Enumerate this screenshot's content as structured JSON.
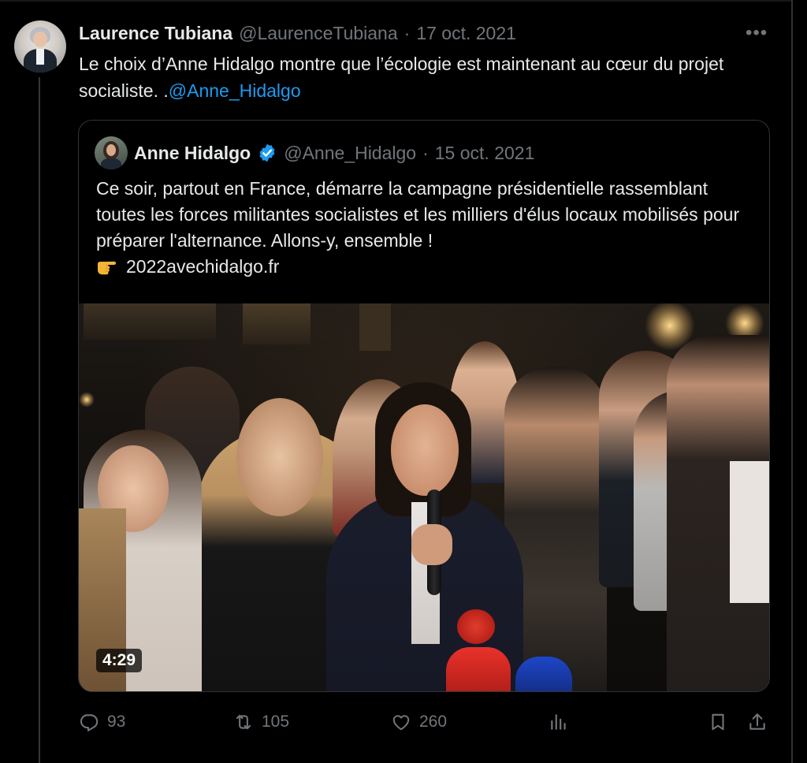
{
  "tweet": {
    "author_name": "Laurence Tubiana",
    "author_handle": "@LaurenceTubiana",
    "separator": "·",
    "date": "17 oct. 2021",
    "text_main": "Le choix d’Anne Hidalgo montre que l’écologie est maintenant au cœur du projet socialiste. .",
    "mention": "@Anne_Hidalgo",
    "more_label": "•••"
  },
  "quote": {
    "author_name": "Anne Hidalgo",
    "verified_icon": "verified-badge-icon",
    "author_handle": "@Anne_Hidalgo",
    "separator": "·",
    "date": "15 oct. 2021",
    "text": "Ce soir, partout en France, démarre la campagne présidentielle rassemblant toutes les forces militantes socialistes et les milliers d'élus locaux mobilisés pour préparer l'alternance. Allons-y, ensemble !",
    "link_emoji_icon": "backhand-pointing-right-icon",
    "link_text": "2022avechidalgo.fr",
    "video_duration": "4:29"
  },
  "actions": {
    "replies": "93",
    "retweets": "105",
    "likes": "260",
    "icons": [
      "reply-icon",
      "retweet-icon",
      "like-icon",
      "views-icon",
      "bookmark-icon",
      "share-icon"
    ]
  },
  "colors": {
    "background": "#000000",
    "text": "#e7e9ea",
    "muted": "#71767b",
    "accent": "#1d9bf0",
    "border": "#2f3336"
  }
}
